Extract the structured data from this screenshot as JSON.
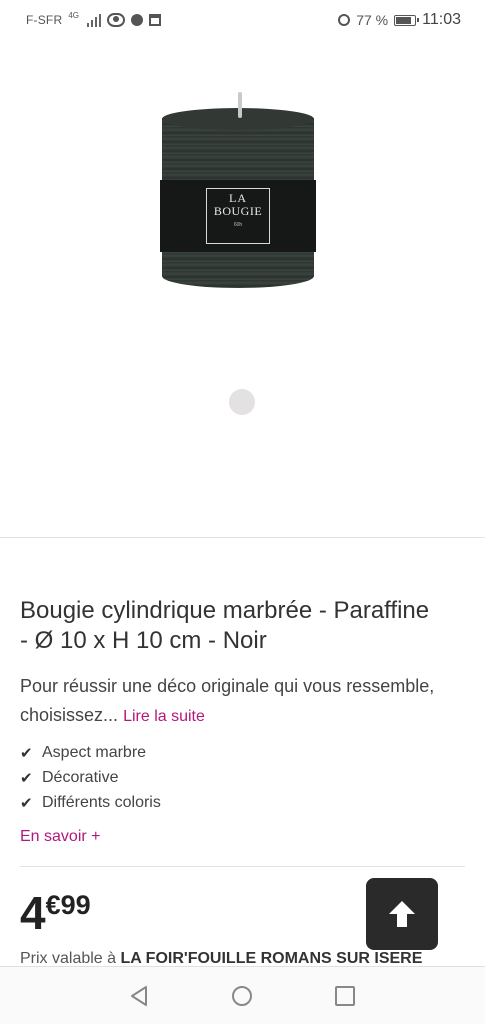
{
  "status_bar": {
    "carrier": "F-SFR",
    "network": "4G",
    "battery": "77 %",
    "time": "11:03"
  },
  "product": {
    "image_label": {
      "brand_line1": "LA",
      "brand_line2": "BOUGIE",
      "small_text": "60h"
    },
    "title": "Bougie cylindrique marbrée - Paraffine - Ø 10 x H 10 cm - Noir",
    "description": "Pour réussir une déco originale qui vous ressemble, choisissez...",
    "read_more": "Lire la suite",
    "features": [
      "Aspect marbre",
      "Décorative",
      "Différents coloris"
    ],
    "learn_more": "En savoir +",
    "price": {
      "integer": "4",
      "cents": "€99"
    },
    "validity": {
      "prefix": "Prix valable à",
      "store": "LA FOIR'FOUILLE ROMANS SUR ISERE"
    }
  },
  "icons": {
    "back_to_top": "arrow-up-icon",
    "nav_back": "triangle-back-icon",
    "nav_home": "circle-home-icon",
    "nav_recents": "square-recents-icon"
  },
  "colors": {
    "accent": "#b0197c",
    "candle": "#323834",
    "back_to_top_bg": "#2a2a2a"
  }
}
